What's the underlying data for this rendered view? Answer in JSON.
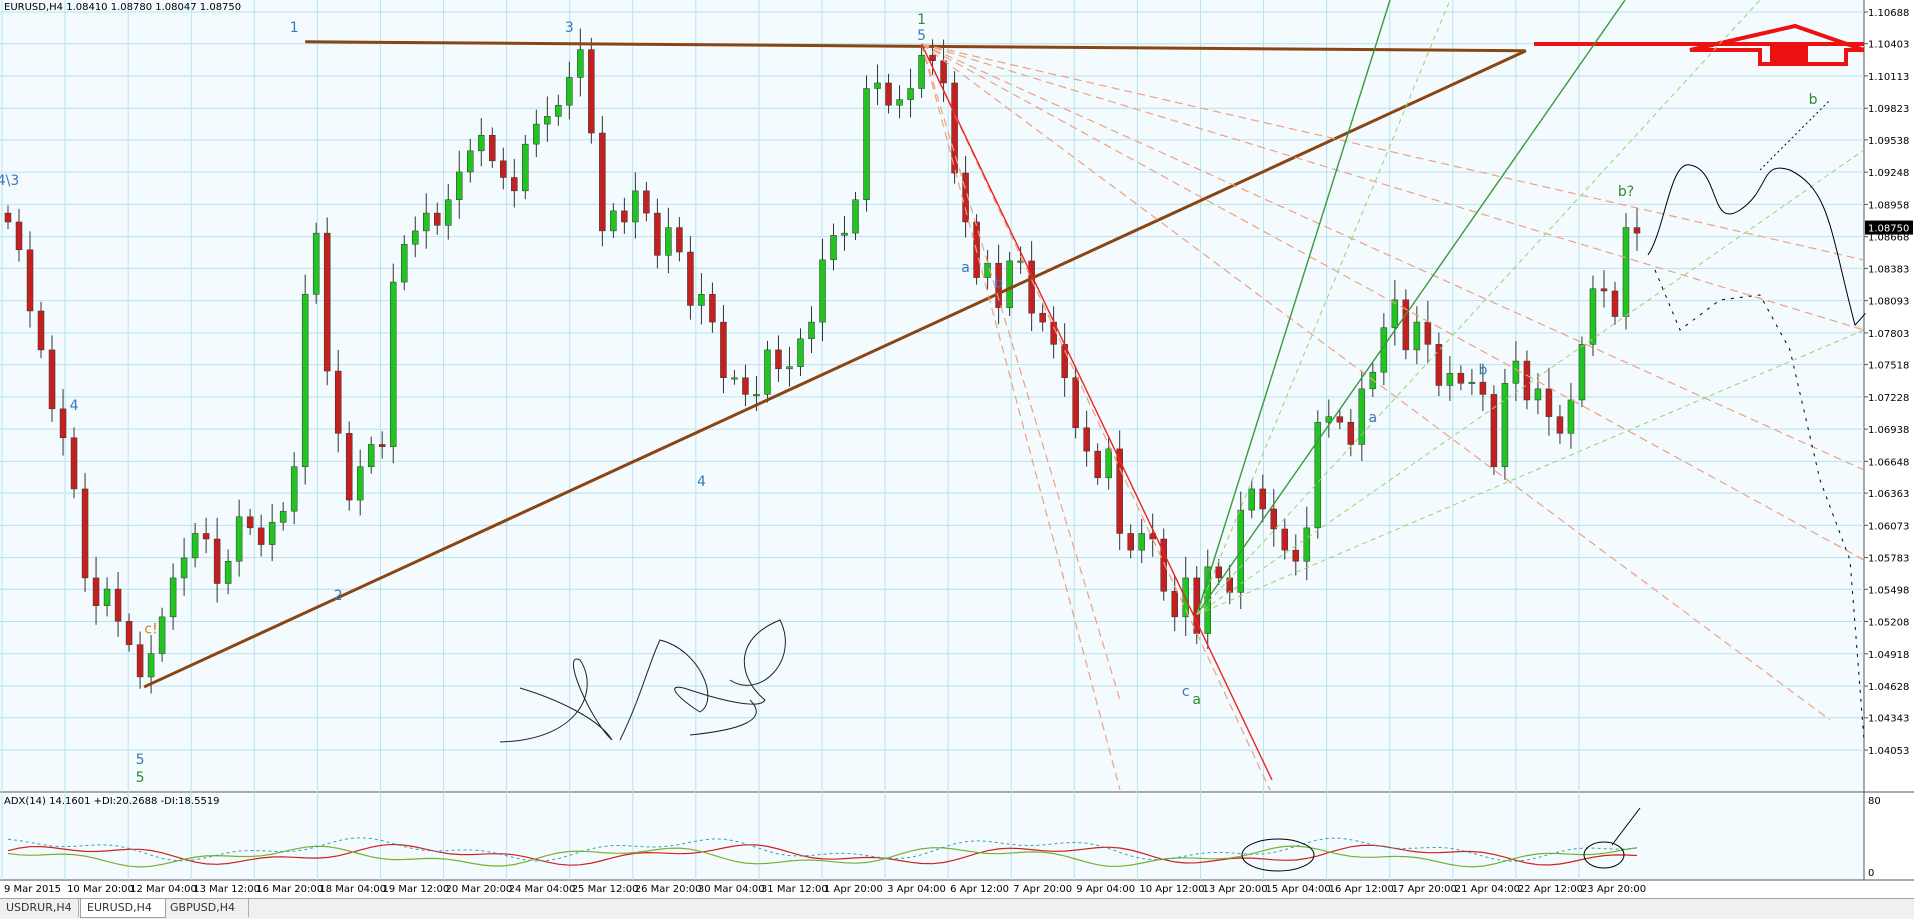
{
  "chart_data": {
    "type": "candlestick",
    "header": "EURUSD,H4  1.08410 1.08780 1.08047 1.08750",
    "symbol": "EURUSD,H4",
    "ohlc": [
      1.0841,
      1.0878,
      1.08047,
      1.0875
    ],
    "last_price_label": "1.08750",
    "price_ticks": [
      "1.10688",
      "1.10403",
      "1.10113",
      "1.09823",
      "1.09538",
      "1.09248",
      "1.08958",
      "1.08668",
      "1.08383",
      "1.08093",
      "1.07803",
      "1.07518",
      "1.07228",
      "1.06938",
      "1.06648",
      "1.06363",
      "1.06073",
      "1.05783",
      "1.05498",
      "1.05208",
      "1.04918",
      "1.04628",
      "1.04343",
      "1.04053"
    ],
    "time_ticks": [
      "9 Mar 2015",
      "10 Mar 20:00",
      "12 Mar 04:00",
      "13 Mar 12:00",
      "16 Mar 20:00",
      "18 Mar 04:00",
      "19 Mar 12:00",
      "20 Mar 20:00",
      "24 Mar 04:00",
      "25 Mar 12:00",
      "26 Mar 20:00",
      "30 Mar 04:00",
      "31 Mar 12:00",
      "1 Apr 20:00",
      "3 Apr 04:00",
      "6 Apr 12:00",
      "7 Apr 20:00",
      "9 Apr 04:00",
      "10 Apr 12:00",
      "13 Apr 20:00",
      "15 Apr 04:00",
      "16 Apr 12:00",
      "17 Apr 20:00",
      "21 Apr 04:00",
      "22 Apr 12:00",
      "23 Apr 20:00"
    ],
    "close_path": [
      1.088,
      1.0855,
      1.08,
      1.0765,
      1.0712,
      1.0686,
      1.064,
      1.056,
      1.0535,
      1.055,
      1.0521,
      1.05,
      1.0471,
      1.0492,
      1.0525,
      1.056,
      1.0578,
      1.06,
      1.0595,
      1.0555,
      1.0575,
      1.0615,
      1.0605,
      1.059,
      1.061,
      1.062,
      1.066,
      1.0815,
      1.087,
      1.0746,
      1.069,
      1.063,
      1.066,
      1.068,
      1.0678,
      1.0826,
      1.086,
      1.0872,
      1.0888,
      1.0877,
      1.09,
      1.0925,
      1.0944,
      1.0958,
      1.0935,
      1.092,
      1.0908,
      1.095,
      1.0968,
      1.0975,
      1.0985,
      1.101,
      1.1035,
      1.096,
      1.0872,
      1.089,
      1.088,
      1.0908,
      1.0888,
      1.085,
      1.0875,
      1.0853,
      1.0805,
      1.0815,
      1.079,
      1.074,
      1.074,
      1.0725,
      1.0725,
      1.0765,
      1.0748,
      1.075,
      1.0775,
      1.079,
      1.0846,
      1.0868,
      1.087,
      1.09,
      1.1,
      1.1005,
      1.0985,
      1.099,
      1.1,
      1.103,
      1.1025,
      1.1005,
      1.0924,
      1.088,
      1.083,
      1.0843,
      1.0803,
      1.0845,
      1.0845,
      1.0798,
      1.079,
      1.077,
      1.074,
      1.0695,
      1.0674,
      1.065,
      1.0676,
      1.06,
      1.0585,
      1.06,
      1.0595,
      1.0548,
      1.0525,
      1.056,
      1.051,
      1.057,
      1.056,
      1.0547,
      1.0621,
      1.064,
      1.0622,
      1.0604,
      1.0585,
      1.0575,
      1.0605,
      1.07,
      1.0705,
      1.07,
      1.068,
      1.073,
      1.0745,
      1.0785,
      1.081,
      1.0765,
      1.079,
      1.077,
      1.0733,
      1.0744,
      1.0735,
      1.0736,
      1.0725,
      1.066,
      1.0735,
      1.0755,
      1.072,
      1.073,
      1.0705,
      1.069,
      1.072,
      1.077,
      1.082,
      1.0818,
      1.0795,
      1.0875,
      1.087
    ],
    "annotations": [
      {
        "text": "1",
        "color": "#3a78b5",
        "i": 26
      },
      {
        "text": "3",
        "color": "#3a78b5",
        "i": 51
      },
      {
        "text": "1",
        "color": "#2e8b2e",
        "i": 83
      },
      {
        "text": "5",
        "color": "#3a78b5",
        "i": 83
      },
      {
        "text": "5",
        "color": "#3a78b5",
        "i": 12
      },
      {
        "text": "5",
        "color": "#2e8b2e",
        "i": 12
      },
      {
        "text": "c!",
        "color": "#e07a10",
        "i": 13
      },
      {
        "text": "4",
        "color": "#3a78b5",
        "i": 6
      },
      {
        "text": "2",
        "color": "#3a78b5",
        "i": 30
      },
      {
        "text": "4",
        "color": "#3a78b5",
        "i": 63
      },
      {
        "text": "b",
        "color": "#3a78b5",
        "i": 90
      },
      {
        "text": "a",
        "color": "#3a78b5",
        "i": 87
      },
      {
        "text": "c",
        "color": "#3a78b5",
        "i": 107
      },
      {
        "text": "a",
        "color": "#2e8b2e",
        "i": 108
      },
      {
        "text": "a",
        "color": "#3a78b5",
        "i": 124
      },
      {
        "text": "b",
        "color": "#3a78b5",
        "i": 134
      },
      {
        "text": "b?",
        "color": "#2e8b2e",
        "i": 147
      },
      {
        "text": "b",
        "color": "#2e8b2e",
        "i": 164
      },
      {
        "text": "4\\3",
        "color": "#3a78b5",
        "i": 0
      }
    ],
    "indicator": {
      "label": "ADX(14) 14.1601 +DI:20.2688 -DI:18.5519",
      "adx": 14.1601,
      "plus_di": 20.2688,
      "minus_di": 18.5519,
      "scale_ticks": [
        "80",
        "0"
      ]
    },
    "colors": {
      "up": "#22c422",
      "down": "#c42020",
      "trend": "#8b4513",
      "resistance": "#ee1111",
      "fan_dashed": "#f0a080",
      "fan_green": "#3a9a3a"
    }
  },
  "tabs": [
    {
      "label": "USDRUR,H4",
      "active": false
    },
    {
      "label": "EURUSD,H4",
      "active": true
    },
    {
      "label": "GBPUSD,H4",
      "active": false
    }
  ]
}
